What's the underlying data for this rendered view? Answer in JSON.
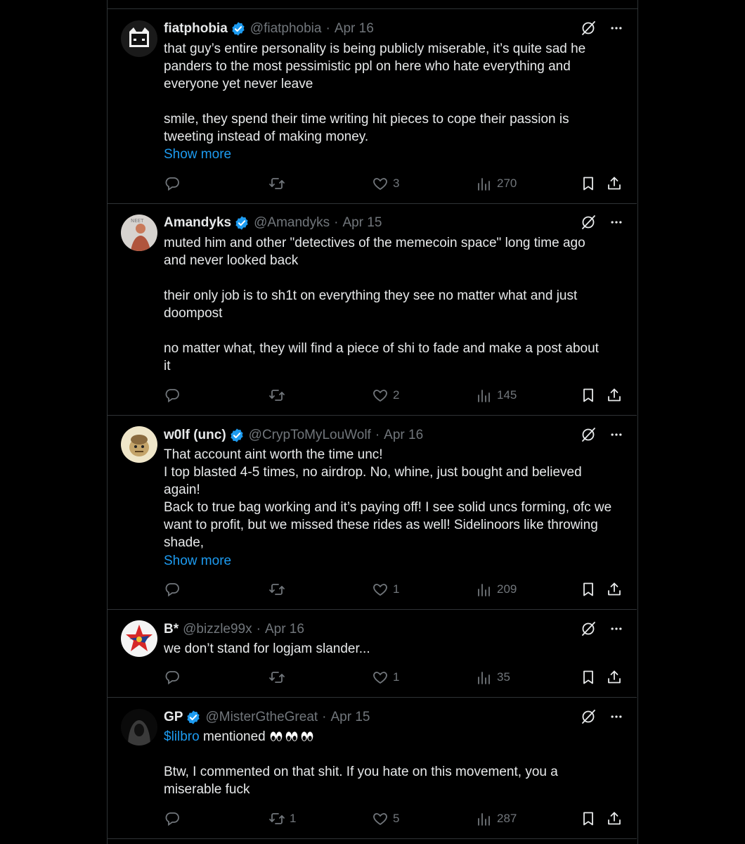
{
  "tweets": [
    {
      "name": "fiatphobia",
      "handle": "@fiatphobia",
      "date": "Apr 16",
      "verified": true,
      "text": "that guy’s entire personality is being publicly miserable, it’s quite sad he\npanders to the most pessimistic ppl on here who hate everything and\neveryone yet never leave\n\nsmile, they spend their time writing hit pieces to cope their passion is\ntweeting instead of making money.",
      "show_more": "Show more",
      "replies": "",
      "retweets": "",
      "likes": "3",
      "views": "270"
    },
    {
      "name": "Amandyks",
      "handle": "@Amandyks",
      "date": "Apr 15",
      "verified": true,
      "avatar_text": "NEET",
      "text": "muted him and other \"detectives of the memecoin space\" long time ago\nand never looked back\n\ntheir only job is to sh1t on everything they see no matter what and just\ndoompost\n\nno matter what, they will find a piece of shi to fade and make a post about\nit",
      "replies": "",
      "retweets": "",
      "likes": "2",
      "views": "145"
    },
    {
      "name": "w0lf (unc)",
      "handle": "@CrypToMyLouWolf",
      "date": "Apr 16",
      "verified": true,
      "text": "That account aint worth the time unc!\nI top blasted 4-5 times, no airdrop. No, whine, just bought and believed\nagain!\nBack to true bag working and it’s paying off! I see solid uncs forming, ofc we\nwant to profit, but we missed these rides as well! Sidelinoors like throwing\nshade,",
      "show_more": "Show more",
      "replies": "",
      "retweets": "",
      "likes": "1",
      "views": "209"
    },
    {
      "name": "B*",
      "handle": "@bizzle99x",
      "date": "Apr 16",
      "verified": false,
      "text": "we don’t stand for logjam slander...",
      "replies": "",
      "retweets": "",
      "likes": "1",
      "views": "35"
    },
    {
      "name": "GP",
      "handle": "@MisterGtheGreat",
      "date": "Apr 15",
      "verified": true,
      "cashtag": "$lilbro",
      "mention_text": " mentioned ",
      "text": "Btw, I commented on that shit. If you hate on this movement, you a\nmiserable fuck",
      "replies": "",
      "retweets": "1",
      "likes": "5",
      "views": "287"
    }
  ],
  "colors": {
    "accent": "#1d9bf0",
    "muted": "#71767b",
    "text": "#e7e9ea",
    "border": "#2f3336",
    "background": "#000000"
  },
  "icons": {
    "reply": "reply-icon",
    "retweet": "retweet-icon",
    "like": "heart-icon",
    "views": "views-icon",
    "bookmark": "bookmark-icon",
    "share": "share-icon",
    "grok": "grok-icon",
    "more": "more-icon",
    "verified": "verified-badge-icon"
  }
}
